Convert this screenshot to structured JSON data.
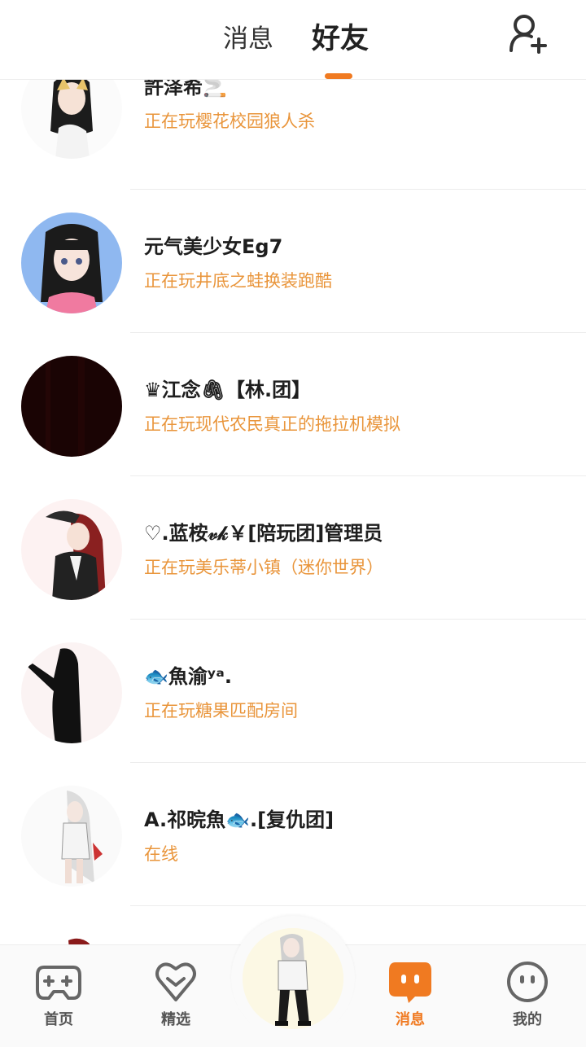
{
  "header": {
    "tab_messages": "消息",
    "tab_friends": "好友",
    "add_friend_icon": "add-user-icon",
    "accent_color": "#f07a21"
  },
  "friends": [
    {
      "name": "許泽希🚬",
      "status": "正在玩樱花校园狼人杀"
    },
    {
      "name": "元气美少女Eg7",
      "status": "正在玩井底之蛙换装跑酷"
    },
    {
      "name": "♛江念🖇【林.团】",
      "status": "正在玩现代农民真正的拖拉机模拟"
    },
    {
      "name": "♡.蓝桉𝓋𝓀￥[陪玩团]管理员",
      "status": "正在玩美乐蒂小镇（迷你世界）"
    },
    {
      "name": "🐟魚渝ʸᵃ.",
      "status": "正在玩糖果匹配房间"
    },
    {
      "name": "A.祁晥魚🐟.[复仇团]",
      "status": "在线"
    }
  ],
  "bottom_nav": {
    "home": "首页",
    "featured": "精选",
    "messages": "消息",
    "mine": "我的",
    "active": "messages"
  },
  "colors": {
    "status_text": "#e9953b",
    "active_nav": "#f07a21",
    "inactive_nav": "#555555"
  }
}
